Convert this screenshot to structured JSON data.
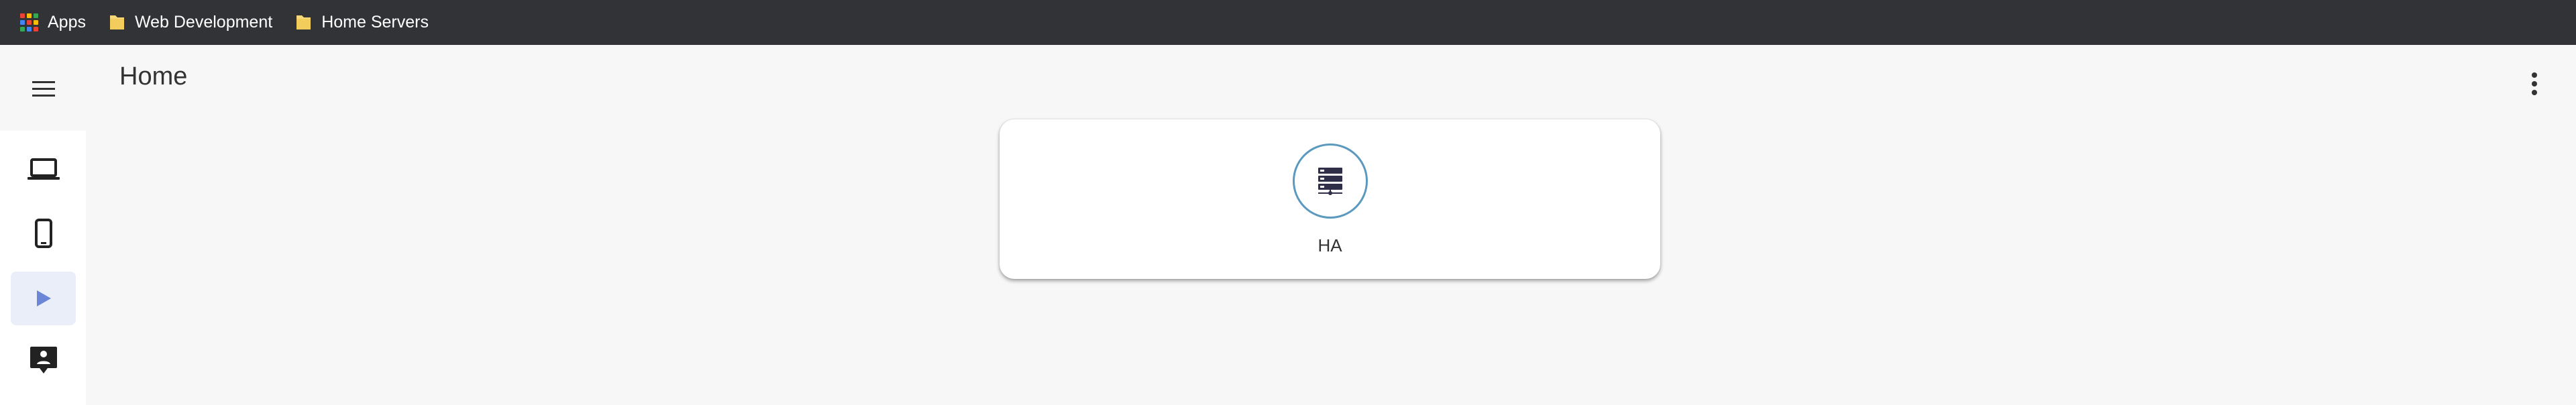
{
  "bookmarks": {
    "items": [
      {
        "label": "Apps",
        "icon": "apps-grid-icon"
      },
      {
        "label": "Web Development",
        "icon": "folder-icon"
      },
      {
        "label": "Home Servers",
        "icon": "folder-icon"
      }
    ]
  },
  "header": {
    "title": "Home",
    "menu_icon": "hamburger-menu-icon",
    "more_icon": "more-vertical-icon"
  },
  "sidebar": {
    "items": [
      {
        "icon": "laptop-icon",
        "active": false
      },
      {
        "icon": "phone-icon",
        "active": false
      },
      {
        "icon": "play-icon",
        "active": true
      },
      {
        "icon": "contact-support-icon",
        "active": false
      }
    ]
  },
  "main": {
    "cards": [
      {
        "label": "HA",
        "icon": "server-icon"
      }
    ]
  },
  "colors": {
    "bookmark_bar": "#323336",
    "background": "#f7f7f7",
    "accent": "#6b86d6",
    "card_ring": "#5c99bf",
    "icon_dark": "#2f2f4a",
    "folder": "#f6d77a"
  }
}
